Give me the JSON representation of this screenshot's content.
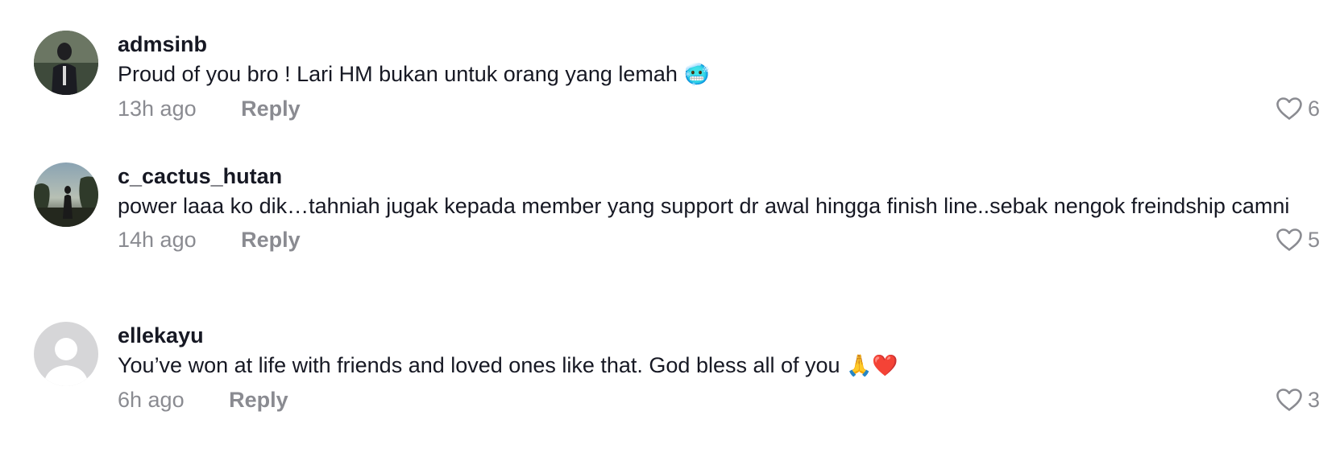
{
  "comments": [
    {
      "username": "admsinb",
      "text": "Proud of you bro ! Lari HM bukan untuk orang yang lemah",
      "emoji": "🥶",
      "time": "13h ago",
      "reply_label": "Reply",
      "likes": "6"
    },
    {
      "username": "c_cactus_hutan",
      "text": "power laaa ko dik…tahniah jugak kepada member yang support dr awal hingga finish line..sebak nengok freindship camni",
      "emoji": "",
      "time": "14h ago",
      "reply_label": "Reply",
      "likes": "5"
    },
    {
      "username": "ellekayu",
      "text": "You’ve won at life with friends and loved ones like that. God bless all of you",
      "emoji": "🙏❤️",
      "time": "6h ago",
      "reply_label": "Reply",
      "likes": "3"
    }
  ],
  "colors": {
    "text": "#161823",
    "secondary": "#8a8b91",
    "background": "#ffffff"
  },
  "icons": {
    "like": "heart-outline-icon"
  }
}
